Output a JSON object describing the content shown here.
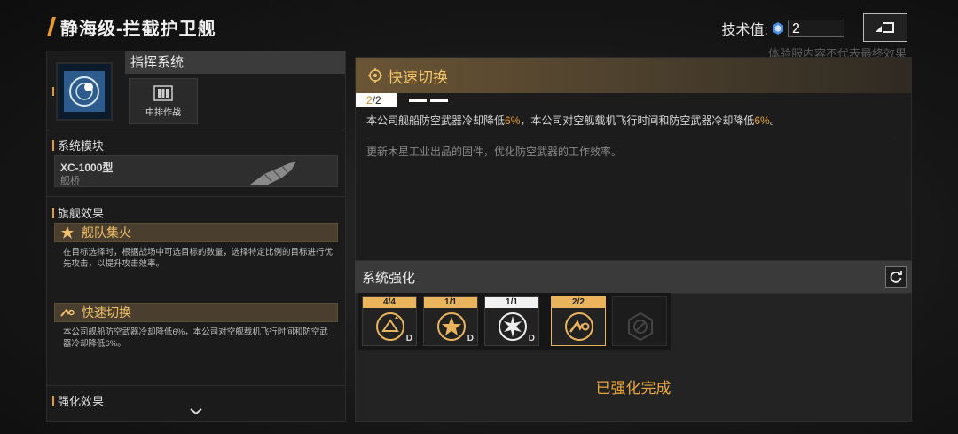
{
  "header": {
    "title": "静海级-拦截护卫舰",
    "tech_label": "技术值:",
    "tech_value": "2",
    "disclaimer": "体验服内容不代表最终效果",
    "back_icon": "return-icon"
  },
  "left": {
    "system_title": "指挥系统",
    "mid_label": "中排作战",
    "module_section": "系统模块",
    "module_name": "XC-1000型",
    "module_sub": "舰桥",
    "flagship_section": "旗舰效果",
    "effects": [
      {
        "name": "舰队集火",
        "desc": "在目标选择时，根据战场中可选目标的数量，选择特定比例的目标进行优先攻击，以提升攻击效率。"
      },
      {
        "name": "快速切换",
        "desc": "本公司舰船防空武器冷却降低6%，本公司对空舰载机飞行时间和防空武器冷却降低6%。"
      }
    ],
    "enhance_section": "强化效果"
  },
  "skill": {
    "name": "快速切换",
    "level_current": "2",
    "level_total": "/2",
    "desc_parts": [
      "本公司舰船防空武器冷却降低",
      "6%",
      "，本公司对空舰载机飞行时间和防空武器冷却降低",
      "6%",
      "。"
    ],
    "flavor": "更新木星工业出品的固件，优化防空武器的工作效率。"
  },
  "enhance": {
    "title": "系统强化",
    "slots": [
      {
        "level": "4/4",
        "grade": "D",
        "icon": "ship-upgrade-icon",
        "style": "gold"
      },
      {
        "level": "1/1",
        "grade": "D",
        "icon": "fleet-fire-icon",
        "style": "gold"
      },
      {
        "level": "1/1",
        "grade": "D",
        "icon": "burst-icon",
        "style": "white"
      },
      {
        "level": "2/2",
        "grade": "",
        "icon": "quick-switch-icon",
        "style": "gold"
      },
      {
        "level": "",
        "grade": "",
        "icon": "locked-slot-icon",
        "style": "locked"
      }
    ],
    "status": "已强化完成"
  },
  "colors": {
    "accent": "#e9b45c",
    "highlight": "#e7a238",
    "panel": "#1b1b1b"
  }
}
